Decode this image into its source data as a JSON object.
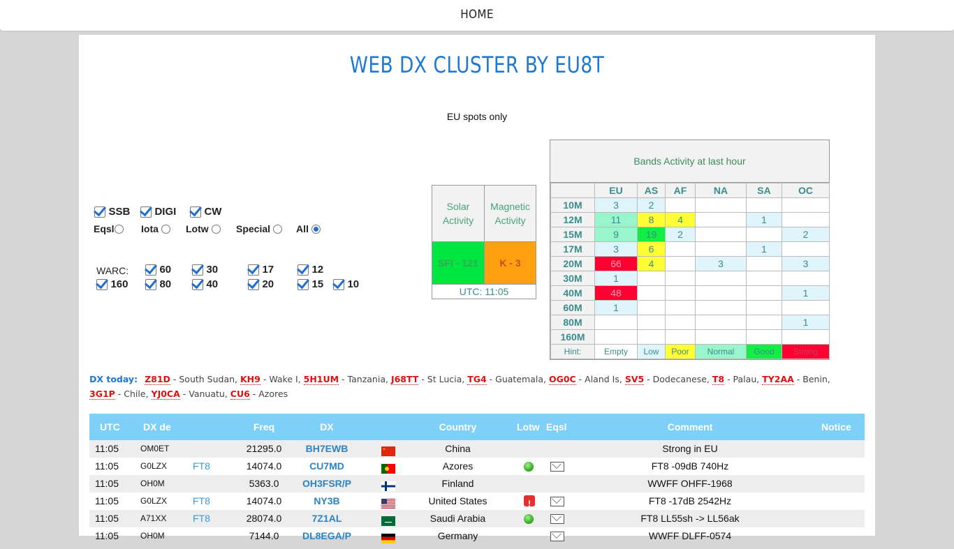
{
  "nav": {
    "home": "HOME"
  },
  "page": {
    "title": "WEB DX CLUSTER BY EU8T",
    "subtitle": "EU spots only"
  },
  "filters": {
    "modes": [
      "SSB",
      "DIGI",
      "CW"
    ],
    "qsl": [
      "Eqsl",
      "Iota",
      "Lotw",
      "Special",
      "All"
    ],
    "qsl_selected": "All",
    "warc_label": "WARC:",
    "bands_row1": [
      "60",
      "30",
      "17",
      "12"
    ],
    "bands_row2": [
      "160",
      "80",
      "40",
      "20",
      "15",
      "10"
    ]
  },
  "solar": {
    "solar_label": "Solar Activity",
    "magnetic_label": "Magnetic Activity",
    "sfi": "SFI - 121",
    "k": "K - 3",
    "utc": "UTC: 11:05"
  },
  "bands_activity": {
    "caption": "Bands Activity at last hour",
    "regions": [
      "EU",
      "AS",
      "AF",
      "NA",
      "SA",
      "OC"
    ],
    "rows": [
      {
        "band": "10M",
        "cells": [
          "3",
          "2",
          "",
          "",
          "",
          ""
        ]
      },
      {
        "band": "12M",
        "cells": [
          "11",
          "8",
          "4",
          "",
          "1",
          ""
        ]
      },
      {
        "band": "15M",
        "cells": [
          "9",
          "19",
          "2",
          "",
          "",
          "2"
        ]
      },
      {
        "band": "17M",
        "cells": [
          "3",
          "6",
          "",
          "",
          "1",
          ""
        ]
      },
      {
        "band": "20M",
        "cells": [
          "66",
          "4",
          "",
          "3",
          "",
          "3"
        ]
      },
      {
        "band": "30M",
        "cells": [
          "1",
          "",
          "",
          "",
          "",
          ""
        ]
      },
      {
        "band": "40M",
        "cells": [
          "48",
          "",
          "",
          "",
          "",
          "1"
        ]
      },
      {
        "band": "60M",
        "cells": [
          "1",
          "",
          "",
          "",
          "",
          ""
        ]
      },
      {
        "band": "80M",
        "cells": [
          "",
          "",
          "",
          "",
          "",
          "1"
        ]
      },
      {
        "band": "160M",
        "cells": [
          "",
          "",
          "",
          "",
          "",
          ""
        ]
      }
    ],
    "hint_label": "Hint:",
    "hints": [
      "Empty",
      "Low",
      "Poor",
      "Normal",
      "Good",
      "Strong"
    ],
    "colors": {
      "empty": "#ffffff",
      "low": "#e0f4fc",
      "poor": "#ffff33",
      "normal": "#99f5cc",
      "good": "#11ee44",
      "strong": "#ff0033"
    }
  },
  "dx_today": {
    "label": "DX today:",
    "entries": [
      {
        "call": "Z81D",
        "name": "South Sudan"
      },
      {
        "call": "KH9",
        "name": "Wake I"
      },
      {
        "call": "5H1UM",
        "name": "Tanzania"
      },
      {
        "call": "J68TT",
        "name": "St Lucia"
      },
      {
        "call": "TG4",
        "name": "Guatemala"
      },
      {
        "call": "OG0C",
        "name": "Aland Is"
      },
      {
        "call": "SV5",
        "name": "Dodecanese"
      },
      {
        "call": "T8",
        "name": "Palau"
      },
      {
        "call": "TY2AA",
        "name": "Benin"
      },
      {
        "call": "3G1P",
        "name": "Chile"
      },
      {
        "call": "YJ0CA",
        "name": "Vanuatu"
      },
      {
        "call": "CU6",
        "name": "Azores"
      }
    ]
  },
  "spots": {
    "headers": {
      "utc": "UTC",
      "de": "DX de",
      "freq": "Freq",
      "dx": "DX",
      "country": "Country",
      "lotw": "Lotw",
      "eqsl": "Eqsl",
      "comment": "Comment",
      "notice": "Notice"
    },
    "rows": [
      {
        "utc": "11:05",
        "de": "OM0ET",
        "mode": "",
        "freq": "21295.0",
        "dx": "BH7EWB",
        "flag": "cn",
        "country": "China",
        "lotw": "",
        "eqsl": false,
        "comment": "Strong in EU"
      },
      {
        "utc": "11:05",
        "de": "G0LZX",
        "mode": "FT8",
        "freq": "14074.0",
        "dx": "CU7MD",
        "flag": "pt",
        "country": "Azores",
        "lotw": "ok",
        "eqsl": true,
        "comment": "FT8 -09dB 740Hz"
      },
      {
        "utc": "11:05",
        "de": "OH0M",
        "mode": "",
        "freq": "5363.0",
        "dx": "OH3FSR/P",
        "flag": "fi",
        "country": "Finland",
        "lotw": "",
        "eqsl": false,
        "comment": "WWFF OHFF-1968"
      },
      {
        "utc": "11:05",
        "de": "G0LZX",
        "mode": "FT8",
        "freq": "14074.0",
        "dx": "NY3B",
        "flag": "us",
        "country": "United States",
        "lotw": "warn",
        "eqsl": true,
        "comment": "FT8 -17dB 2542Hz"
      },
      {
        "utc": "11:05",
        "de": "A71XX",
        "mode": "FT8",
        "freq": "28074.0",
        "dx": "7Z1AL",
        "flag": "sa",
        "country": "Saudi Arabia",
        "lotw": "ok",
        "eqsl": true,
        "comment": "FT8 LL55sh -> LL56ak"
      },
      {
        "utc": "11:05",
        "de": "OH0M",
        "mode": "",
        "freq": "7144.0",
        "dx": "DL8EGA/P",
        "flag": "de",
        "country": "Germany",
        "lotw": "",
        "eqsl": true,
        "comment": "WWFF DLFF-0574"
      }
    ]
  }
}
